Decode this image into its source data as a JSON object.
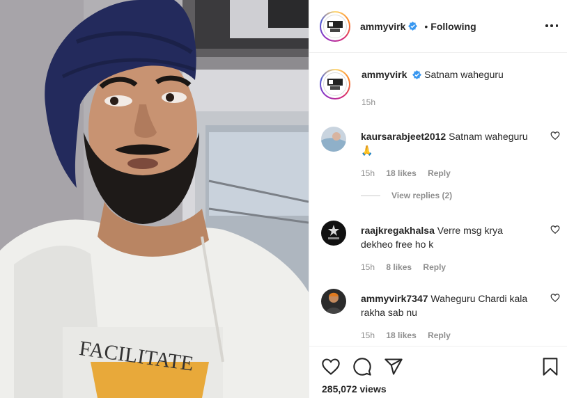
{
  "header": {
    "username": "ammyvirk",
    "separator": "•",
    "follow_state": "Following"
  },
  "caption": {
    "username": "ammyvirk",
    "text": "Satnam waheguru",
    "time": "15h"
  },
  "comments": [
    {
      "username": "kaursarabjeet2012",
      "text": "Satnam waheguru 🙏",
      "time": "15h",
      "likes": "18 likes",
      "reply": "Reply"
    },
    {
      "username": "raajkregakhalsa",
      "text": "Verre msg krya dekheo free ho k",
      "time": "15h",
      "likes": "8 likes",
      "reply": "Reply"
    },
    {
      "username": "ammyvirk7347",
      "text": "Waheguru Chardi kala rakha sab nu",
      "time": "15h",
      "likes": "18 likes",
      "reply": "Reply"
    }
  ],
  "view_replies": "View replies (2)",
  "stats": {
    "views": "285,072 views"
  },
  "colors": {
    "verified": "#3897f0",
    "text": "#262626",
    "muted": "#8e8e8e",
    "border": "#efefef",
    "turban": "#232a5c"
  },
  "icons": [
    "more-options-icon",
    "verified-badge-icon",
    "heart-icon",
    "comment-icon",
    "share-icon",
    "bookmark-icon"
  ]
}
